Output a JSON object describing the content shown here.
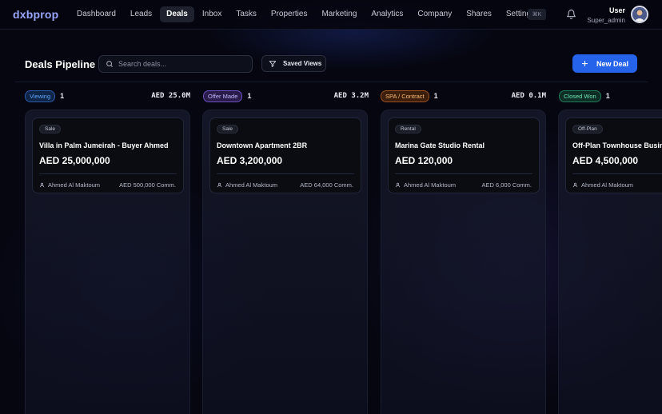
{
  "brand": "dxbprop",
  "nav": [
    {
      "label": "Dashboard",
      "active": false
    },
    {
      "label": "Leads",
      "active": false
    },
    {
      "label": "Deals",
      "active": true
    },
    {
      "label": "Inbox",
      "active": false
    },
    {
      "label": "Tasks",
      "active": false
    },
    {
      "label": "Properties",
      "active": false
    },
    {
      "label": "Marketing",
      "active": false
    },
    {
      "label": "Analytics",
      "active": false
    },
    {
      "label": "Company",
      "active": false
    },
    {
      "label": "Shares",
      "active": false
    },
    {
      "label": "Settings",
      "active": false
    }
  ],
  "shortcut": "⌘K",
  "user": {
    "name": "User",
    "role": "Super_admin"
  },
  "page": {
    "title": "Deals Pipeline",
    "search_placeholder": "Search deals...",
    "saved_views": "Saved Views",
    "new_deal": "New Deal"
  },
  "stages": [
    {
      "name": "Viewing",
      "count": "1",
      "total": "AED 25.0M",
      "color": "#60a5fa",
      "bg": "#0f2547",
      "border": "#2b5aa8",
      "deal": {
        "type": "Sale",
        "title": "Villa in Palm Jumeirah - Buyer Ahmed",
        "price": "AED 25,000,000",
        "agent": "Ahmed Al Maktoum",
        "commission": "AED 500,000 Comm."
      }
    },
    {
      "name": "Offer Made",
      "count": "1",
      "total": "AED 3.2M",
      "color": "#c4b5fd",
      "bg": "#2a1c4a",
      "border": "#6d4fc2",
      "deal": {
        "type": "Sale",
        "title": "Downtown Apartment 2BR",
        "price": "AED 3,200,000",
        "agent": "Ahmed Al Maktoum",
        "commission": "AED 64,000 Comm."
      }
    },
    {
      "name": "SPA / Contract",
      "count": "1",
      "total": "AED 0.1M",
      "color": "#fdba74",
      "bg": "#3b1f0c",
      "border": "#9a4f1c",
      "deal": {
        "type": "Rental",
        "title": "Marina Gate Studio Rental",
        "price": "AED 120,000",
        "agent": "Ahmed Al Maktoum",
        "commission": "AED 6,000 Comm."
      }
    },
    {
      "name": "Closed Won",
      "count": "1",
      "total": "",
      "color": "#6ee7b7",
      "bg": "#0c2e24",
      "border": "#1f7a5a",
      "deal": {
        "type": "Off-Plan",
        "title": "Off-Plan Townhouse Business Bay",
        "price": "AED 4,500,000",
        "agent": "Ahmed Al Maktoum",
        "commission": ""
      }
    }
  ]
}
